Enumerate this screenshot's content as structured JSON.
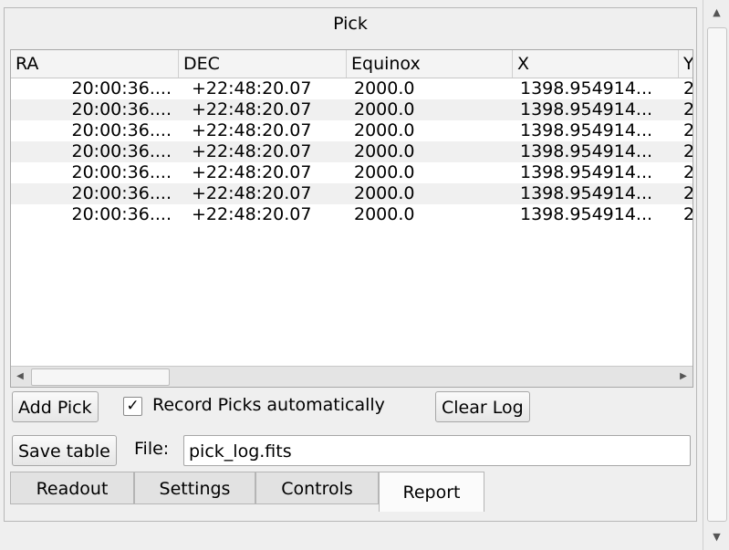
{
  "panel": {
    "title": "Pick"
  },
  "table": {
    "columns": [
      "RA",
      "DEC",
      "Equinox",
      "X",
      "Y"
    ],
    "rows": [
      [
        "20:00:36....",
        "+22:48:20.07",
        "2000.0",
        "1398.954914...",
        "2"
      ],
      [
        "20:00:36....",
        "+22:48:20.07",
        "2000.0",
        "1398.954914...",
        "2"
      ],
      [
        "20:00:36....",
        "+22:48:20.07",
        "2000.0",
        "1398.954914...",
        "2"
      ],
      [
        "20:00:36....",
        "+22:48:20.07",
        "2000.0",
        "1398.954914...",
        "2"
      ],
      [
        "20:00:36....",
        "+22:48:20.07",
        "2000.0",
        "1398.954914...",
        "2"
      ],
      [
        "20:00:36....",
        "+22:48:20.07",
        "2000.0",
        "1398.954914...",
        "2"
      ],
      [
        "20:00:36....",
        "+22:48:20.07",
        "2000.0",
        "1398.954914...",
        "2"
      ]
    ]
  },
  "controls": {
    "add_pick_label": "Add Pick",
    "record_checked": true,
    "record_check_mark": "✓",
    "record_label": "Record Picks automatically",
    "clear_log_label": "Clear Log",
    "save_table_label": "Save table",
    "file_label": "File:",
    "file_value": "pick_log.fits"
  },
  "tabs": [
    {
      "label": "Readout",
      "active": false
    },
    {
      "label": "Settings",
      "active": false
    },
    {
      "label": "Controls",
      "active": false
    },
    {
      "label": "Report",
      "active": true
    }
  ],
  "icons": {
    "left_arrow": "◀",
    "right_arrow": "▶",
    "up_arrow": "▲",
    "down_arrow": "▼"
  }
}
